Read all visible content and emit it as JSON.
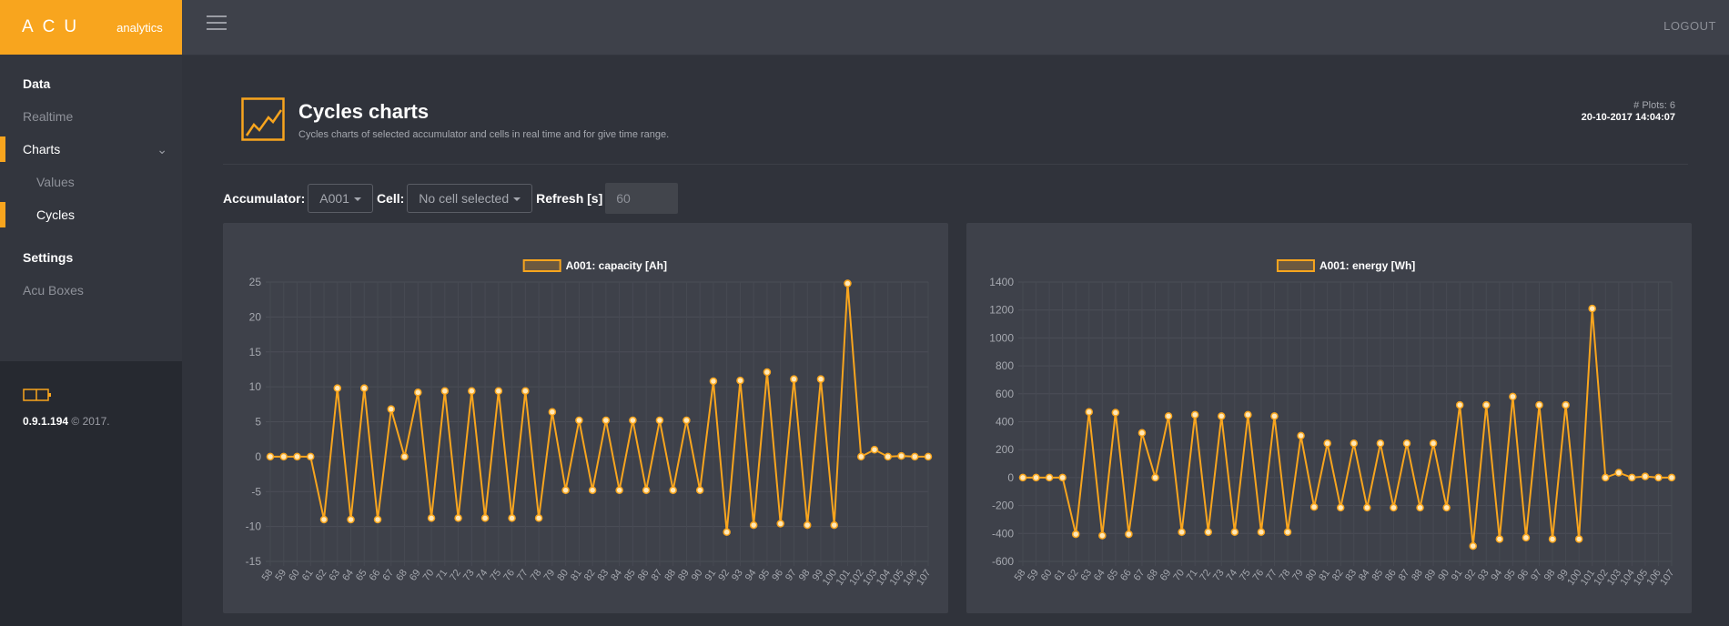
{
  "app": {
    "name": "ACU",
    "subtitle": "analytics"
  },
  "topbar": {
    "logout_label": "LOGOUT"
  },
  "sidebar": {
    "items": [
      {
        "label": "Data"
      },
      {
        "label": "Realtime"
      },
      {
        "label": "Charts"
      },
      {
        "label": "Values"
      },
      {
        "label": "Cycles"
      },
      {
        "label": "Settings"
      },
      {
        "label": "Acu Boxes"
      }
    ],
    "version": "0.9.1.194",
    "copyright": "© 2017."
  },
  "header": {
    "title": "Cycles charts",
    "description": "Cycles charts of selected accumulator and cells in real time and for give time range.",
    "plots_count": "# Plots: 6",
    "datetime": "20-10-2017 14:04:07"
  },
  "filters": {
    "accumulator_label": "Accumulator:",
    "accumulator_value": "A001",
    "cell_label": "Cell:",
    "cell_value": "No cell selected",
    "refresh_label": "Refresh [s]",
    "refresh_value": "60"
  },
  "colors": {
    "accent": "#f8a51e",
    "panel": "#3e414a",
    "background": "#30333b"
  },
  "chart_data": [
    {
      "type": "line",
      "legend": "A001: capacity [Ah]",
      "x": [
        58,
        59,
        60,
        61,
        62,
        63,
        64,
        65,
        66,
        67,
        68,
        69,
        70,
        71,
        72,
        73,
        74,
        75,
        76,
        77,
        78,
        79,
        80,
        81,
        82,
        83,
        84,
        85,
        86,
        87,
        88,
        89,
        90,
        91,
        92,
        93,
        94,
        95,
        96,
        97,
        98,
        99,
        100,
        101,
        102,
        103,
        104,
        105,
        106,
        107
      ],
      "series": [
        {
          "name": "A001: capacity [Ah]",
          "values": [
            0,
            0,
            0,
            0,
            -9,
            9.8,
            -9,
            9.8,
            -9,
            6.8,
            0,
            9.2,
            -8.8,
            9.4,
            -8.8,
            9.4,
            -8.8,
            9.4,
            -8.8,
            9.4,
            -8.8,
            6.4,
            -4.8,
            5.2,
            -4.8,
            5.2,
            -4.8,
            5.2,
            -4.8,
            5.2,
            -4.8,
            5.2,
            -4.8,
            10.8,
            -10.8,
            10.9,
            -9.8,
            12.1,
            -9.6,
            11.1,
            -9.8,
            11.1,
            -9.8,
            24.8,
            0,
            1,
            0,
            0.1,
            0,
            0
          ]
        }
      ],
      "ylim": [
        -15,
        25
      ],
      "yticks": [
        -15,
        -10,
        -5,
        0,
        5,
        10,
        15,
        20,
        25
      ],
      "legend_position": "top-center",
      "grid": true
    },
    {
      "type": "line",
      "legend": "A001: energy [Wh]",
      "x": [
        58,
        59,
        60,
        61,
        62,
        63,
        64,
        65,
        66,
        67,
        68,
        69,
        70,
        71,
        72,
        73,
        74,
        75,
        76,
        77,
        78,
        79,
        80,
        81,
        82,
        83,
        84,
        85,
        86,
        87,
        88,
        89,
        90,
        91,
        92,
        93,
        94,
        95,
        96,
        97,
        98,
        99,
        100,
        101,
        102,
        103,
        104,
        105,
        106,
        107
      ],
      "series": [
        {
          "name": "A001: energy [Wh]",
          "values": [
            0,
            0,
            0,
            0,
            -405,
            470,
            -415,
            465,
            -405,
            320,
            0,
            440,
            -390,
            450,
            -390,
            440,
            -390,
            450,
            -390,
            440,
            -390,
            300,
            -210,
            245,
            -215,
            245,
            -215,
            245,
            -215,
            245,
            -215,
            245,
            -215,
            520,
            -490,
            520,
            -440,
            580,
            -430,
            520,
            -440,
            520,
            -440,
            1210,
            0,
            35,
            0,
            8,
            0,
            0
          ]
        }
      ],
      "ylim": [
        -600,
        1400
      ],
      "yticks": [
        -600,
        -400,
        -200,
        0,
        200,
        400,
        600,
        800,
        1000,
        1200,
        1400
      ],
      "legend_position": "top-center",
      "grid": true
    }
  ]
}
